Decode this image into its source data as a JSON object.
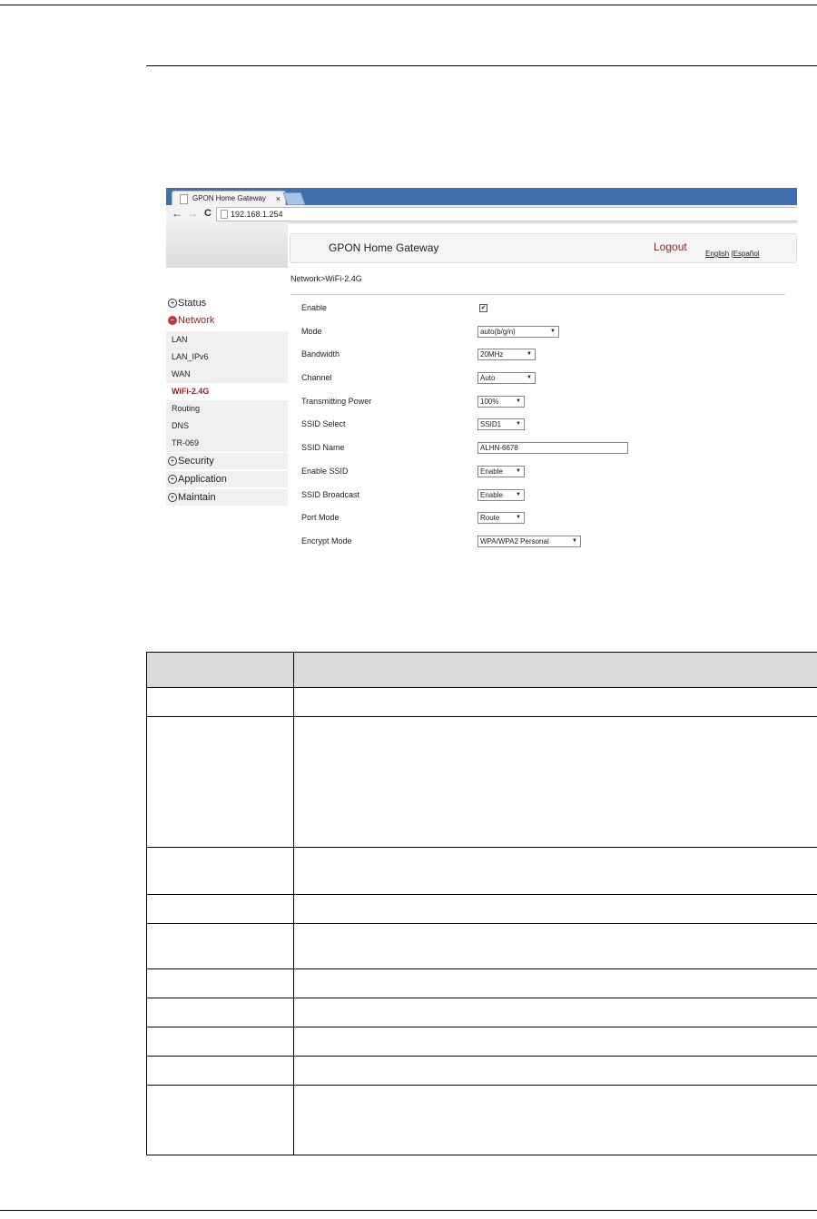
{
  "browser": {
    "tab_title": "GPON Home Gateway",
    "tab_close": "×",
    "back": "←",
    "forward": "→",
    "reload": "C",
    "url": "192.168.1.254"
  },
  "gateway": {
    "title": "GPON Home Gateway",
    "logout": "Logout",
    "lang_english": "English",
    "lang_sep": "|",
    "lang_spanish": "Español",
    "breadcrumb": "Network>WiFi-2.4G"
  },
  "sidebar": {
    "status": "Status",
    "network": "Network",
    "network_items": [
      "LAN",
      "LAN_IPv6",
      "WAN",
      "WiFi-2.4G",
      "Routing",
      "DNS",
      "TR-069"
    ],
    "security": "Security",
    "application": "Application",
    "maintain": "Maintain"
  },
  "form": {
    "enable_label": "Enable",
    "enable_check": "✔",
    "mode_label": "Mode",
    "mode_value": "auto(b/g/n)",
    "bandwidth_label": "Bandwidth",
    "bandwidth_value": "20MHz",
    "channel_label": "Channel",
    "channel_value": "Auto",
    "power_label": "Transmitting Power",
    "power_value": "100%",
    "ssid_select_label": "SSID Select",
    "ssid_select_value": "SSID1",
    "ssid_name_label": "SSID Name",
    "ssid_name_value": "ALHN-6678",
    "enable_ssid_label": "Enable SSID",
    "enable_ssid_value": "Enable",
    "ssid_broadcast_label": "SSID Broadcast",
    "ssid_broadcast_value": "Enable",
    "port_mode_label": "Port Mode",
    "port_mode_value": "Route",
    "encrypt_label": "Encrypt Mode",
    "encrypt_value": "WPA/WPA2 Personal",
    "dropdown_arrow": "▼"
  }
}
